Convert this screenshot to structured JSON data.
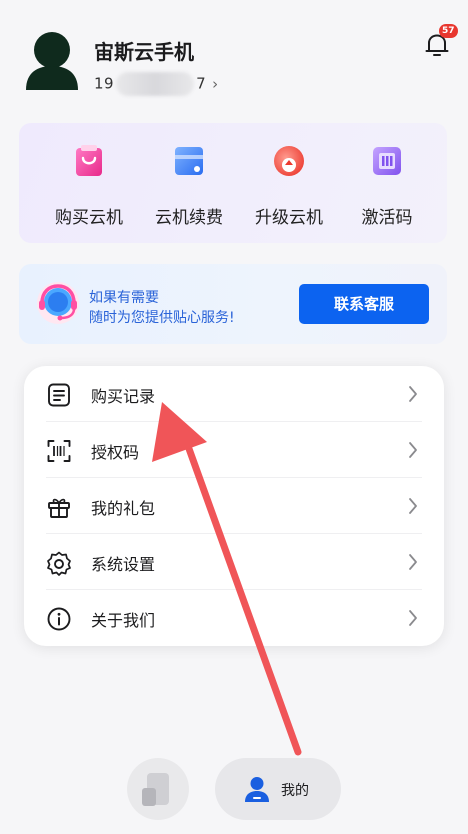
{
  "profile": {
    "name": "宙斯云手机",
    "phone_prefix": "19",
    "phone_suffix": "7",
    "chevron": "›",
    "avatar_icon": "user-silhouette-icon"
  },
  "notifications": {
    "badge_count": "57",
    "icon": "bell-icon"
  },
  "quick_actions": [
    {
      "label": "购买云机",
      "icon": "shopping-bag-icon",
      "color": "#f0409a"
    },
    {
      "label": "云机续费",
      "icon": "renew-card-icon",
      "color": "#3a7bf2"
    },
    {
      "label": "升级云机",
      "icon": "upgrade-icon",
      "color": "#f04a3a"
    },
    {
      "label": "激活码",
      "icon": "activation-code-icon",
      "color": "#8d5cf0"
    }
  ],
  "service": {
    "line1": "如果有需要",
    "line2": "随时为您提供贴心服务!",
    "button_label": "联系客服",
    "icon": "customer-service-headset-icon",
    "accent": "#0c63f0"
  },
  "menu": [
    {
      "label": "购买记录",
      "icon": "record-list-icon"
    },
    {
      "label": "授权码",
      "icon": "scan-code-icon"
    },
    {
      "label": "我的礼包",
      "icon": "gift-icon"
    },
    {
      "label": "系统设置",
      "icon": "gear-icon"
    },
    {
      "label": "关于我们",
      "icon": "info-icon"
    }
  ],
  "bottom_nav": {
    "phone_tab_icon": "phone-icon",
    "mine_tab_label": "我的",
    "mine_tab_icon": "person-icon",
    "active_color": "#1a5fe0"
  },
  "annotation": {
    "color": "#f05558"
  }
}
